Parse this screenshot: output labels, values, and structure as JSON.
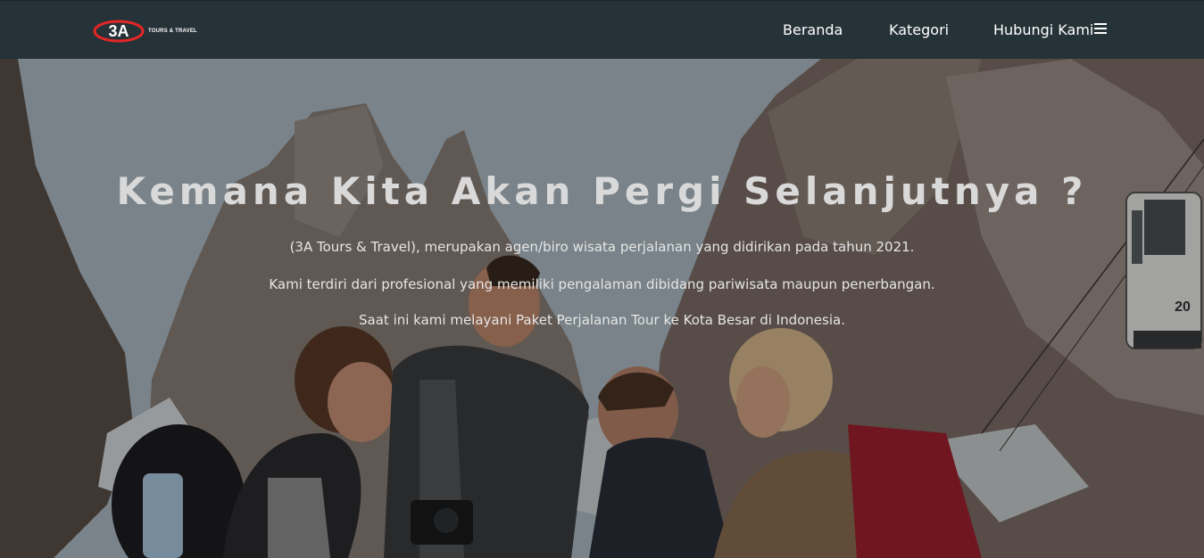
{
  "brand": {
    "logo_mark": "3A",
    "logo_text": "TOURS & TRAVEL",
    "accent_color": "#e32626"
  },
  "nav": {
    "items": [
      {
        "label": "Beranda"
      },
      {
        "label": "Kategori"
      },
      {
        "label": "Hubungi Kami"
      }
    ],
    "menu_icon": "hamburger-icon"
  },
  "hero": {
    "title": "Kemana Kita Akan Pergi Selanjutnya ?",
    "lines": [
      "(3A Tours & Travel), merupakan agen/biro wisata perjalanan yang didirikan pada tahun 2021.",
      "Kami terdiri dari profesional yang memiliki pengalaman dibidang pariwisata maupun penerbangan.",
      "Saat ini kami melayani Paket Perjalanan Tour ke Kota Besar di Indonesia."
    ],
    "cable_car_number": "20"
  },
  "colors": {
    "navbar_bg": "#253238",
    "text_light": "#ffffff"
  }
}
